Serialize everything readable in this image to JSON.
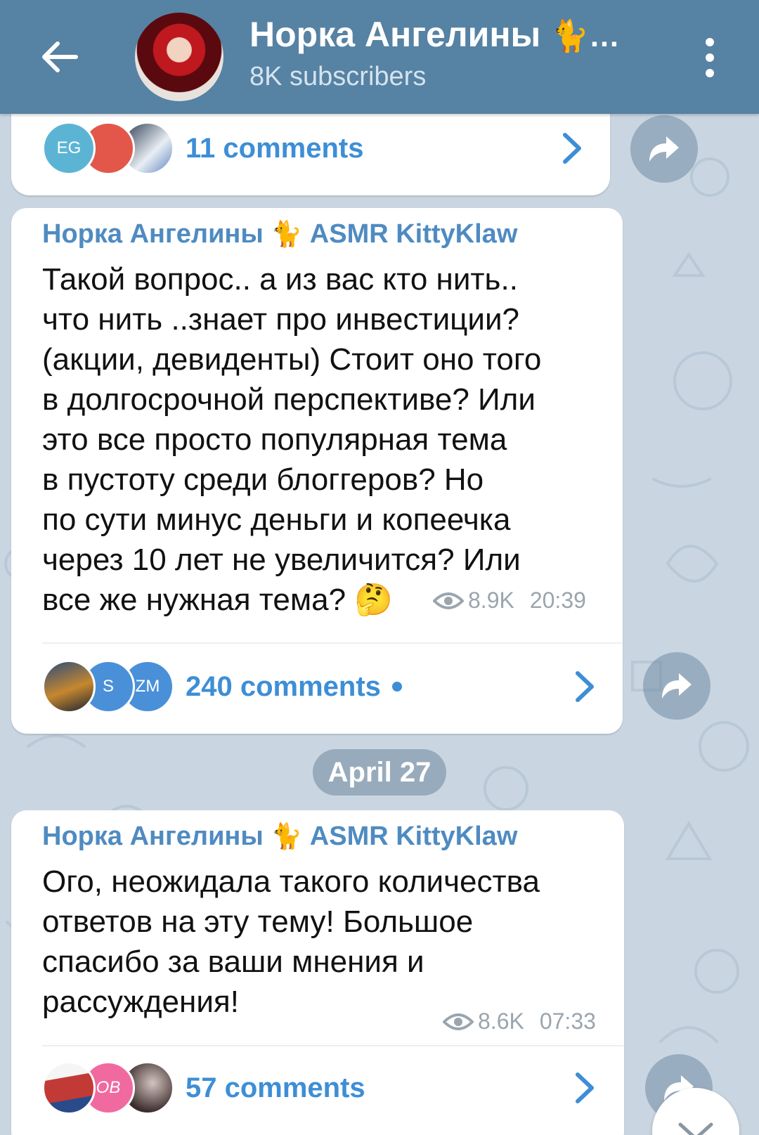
{
  "header": {
    "title": "Норка Ангелины",
    "title_emoji": "🐈…",
    "subtitle": "8K subscribers"
  },
  "messages": [
    {
      "comments": {
        "label": "11 comments",
        "avatars": [
          "EG",
          "",
          ""
        ]
      }
    },
    {
      "sender": "Норка Ангелины",
      "sender_emoji": "🐈",
      "sender_suffix": "ASMR KittyKlaw",
      "text": "Такой вопрос..  а из вас кто нить..\nчто нить ..знает про инвестиции?\n(акции, девиденты) Стоит оно того\nв долгосрочной перспективе? Или\nэто все просто популярная тема\nв пустоту среди блоггеров? Но\nпо сути минус деньги и копеечка\nчерез 10 лет не увеличится? Или\nвсе же нужная тема? 🤔",
      "views": "8.9K",
      "time": "20:39",
      "comments": {
        "label": "240 comments",
        "avatars": [
          "",
          "S",
          "ZM"
        ],
        "unread": true
      }
    },
    {
      "sender": "Норка Ангелины",
      "sender_emoji": "🐈",
      "sender_suffix": "ASMR KittyKlaw",
      "text": "Ого, неожидала такого количества\nответов на эту тему! Большое\nспасибо за ваши мнения и\nрассуждения!",
      "views": "8.6K",
      "time": "07:33",
      "comments": {
        "label": "57 comments",
        "avatars": [
          "",
          "ОВ",
          ""
        ]
      }
    }
  ],
  "date_separator": "April 27",
  "colors": {
    "header_bg": "#5682a3",
    "accent": "#3d8ed6",
    "sender": "#4f8bc1",
    "wallpaper": "#c9d6e2"
  },
  "icons": [
    "back-arrow-icon",
    "more-vertical-icon",
    "eye-icon",
    "chevron-right-icon",
    "share-icon",
    "chevron-down-icon"
  ]
}
